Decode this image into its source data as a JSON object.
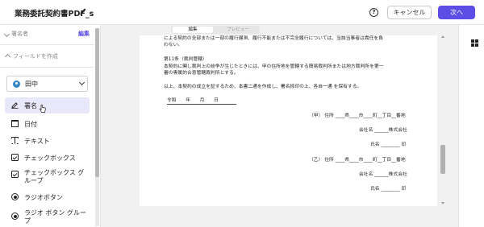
{
  "header": {
    "doc_title": "業務委託契約書PDF_s",
    "cancel_label": "キャンセル",
    "next_label": "次へ",
    "help_symbol": "?"
  },
  "sidebar": {
    "signer_section_label": "署名者",
    "edit_label": "編集",
    "fields_section_label": "フィールドを作成",
    "signer_name": "田中",
    "signer_color": "#2f86c8",
    "items": [
      {
        "label": "署名",
        "icon": "signature-pen-icon",
        "active": true
      },
      {
        "label": "日付",
        "icon": "calendar-icon",
        "active": false
      },
      {
        "label": "テキスト",
        "icon": "text-field-icon",
        "active": false
      },
      {
        "label": "チェックボックス",
        "icon": "checkbox-icon",
        "active": false
      },
      {
        "label": "チェックボックス グループ",
        "icon": "checkbox-group-icon",
        "active": false
      },
      {
        "label": "ラジオボタン",
        "icon": "radio-button-icon",
        "active": false
      },
      {
        "label": "ラジオ ボタン グループ",
        "icon": "radio-group-icon",
        "active": false
      }
    ]
  },
  "canvas": {
    "mode_edit": "編集",
    "mode_preview": "プレビュー",
    "document": {
      "line1": "による契約の全部または一部の履行遅滞、履行不能または不完全履行については、当該当事者は責任を負",
      "line2": "わない。",
      "article11_title": "第11条（裁判管轄）",
      "article11_line1": "本契約に関し裁判上の紛争が生じたときには、甲の住所地を管轄する簡易裁判所または地方裁判所を第一",
      "article11_line2": "審の専属的合意管轄裁判所とする。",
      "closing": "以上、本契約の成立を証するため、本書二通を作成し、署名捺印の上、各自一通 を保有する。",
      "date_line": "令和　　年　　月　　日",
      "party_a_address": "（甲） 住所 ____県____市____町__丁目__番地",
      "party_a_company": "会社名 ______株式会社",
      "party_a_name": "氏名 ________ 印",
      "party_b_address": "（乙） 住所 ____県____市____町__丁目__番地",
      "party_b_company": "会社名 ______株式会社",
      "party_b_name": "氏名 ________ 印"
    }
  },
  "colors": {
    "accent": "#5c4ee5",
    "active_item_bg": "#e9e8fb"
  }
}
